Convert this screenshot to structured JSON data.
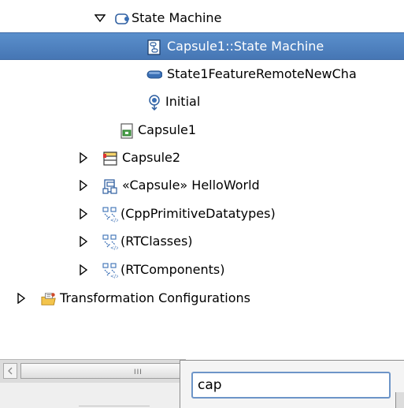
{
  "tree": {
    "items": [
      {
        "label": "State Machine",
        "expanded": true,
        "twisty": "expanded",
        "icon": "state-machine-icon"
      },
      {
        "label": "Capsule1::State Machine",
        "selected": true,
        "icon": "state-machine-diagram-icon"
      },
      {
        "label": "State1FeatureRemoteNewCha",
        "icon": "state-icon"
      },
      {
        "label": "Initial",
        "icon": "initial-pseudostate-icon"
      },
      {
        "label": "Capsule1",
        "icon": "capsule-diagram-icon"
      },
      {
        "label": "Capsule2",
        "twisty": "collapsed",
        "icon": "capsule-class-icon"
      },
      {
        "label": "«Capsule» HelloWorld",
        "twisty": "collapsed",
        "icon": "capsule-icon"
      },
      {
        "label": "(CppPrimitiveDatatypes)",
        "twisty": "collapsed",
        "icon": "model-library-icon"
      },
      {
        "label": "(RTClasses)",
        "twisty": "collapsed",
        "icon": "model-library-icon"
      },
      {
        "label": "(RTComponents)",
        "twisty": "collapsed",
        "icon": "model-library-icon"
      },
      {
        "label": "Transformation Configurations",
        "twisty": "collapsed",
        "icon": "transformation-folder-icon"
      }
    ]
  },
  "scrollbar": {
    "grip": "III"
  },
  "filter_popup": {
    "value": "cap"
  },
  "colors": {
    "selection": "#4f81bd",
    "input_border": "#6d95c8"
  }
}
